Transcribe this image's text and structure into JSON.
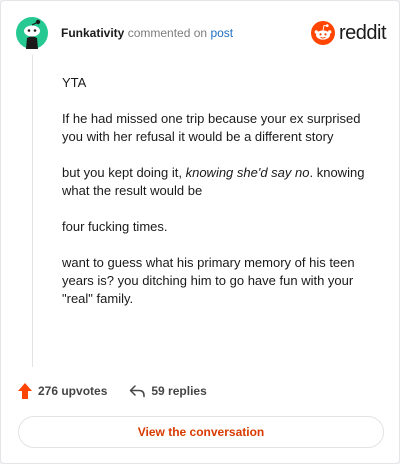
{
  "header": {
    "username": "Funkativity",
    "action": "commented on",
    "target": "post"
  },
  "logo": {
    "text": "reddit",
    "icon": "reddit-alien-icon",
    "brand_color": "#ff4500"
  },
  "avatar": {
    "icon": "snoo-avatar-icon",
    "color": "#27c993"
  },
  "comment": {
    "p1": "YTA",
    "p2": "If he had missed one trip because your ex surprised you with her refusal it would be a different story",
    "p3_before": "but you kept doing it, ",
    "p3_em": "knowing she'd say no",
    "p3_after": ". knowing what the result would be",
    "p4": "four fucking times.",
    "p5": "want to guess what his primary memory of his teen years is? you ditching him to go have fun with your \"real\" family."
  },
  "footer": {
    "upvotes": "276 upvotes",
    "replies": "59 replies"
  },
  "cta": {
    "label": "View the conversation",
    "color": "#d93a00"
  }
}
